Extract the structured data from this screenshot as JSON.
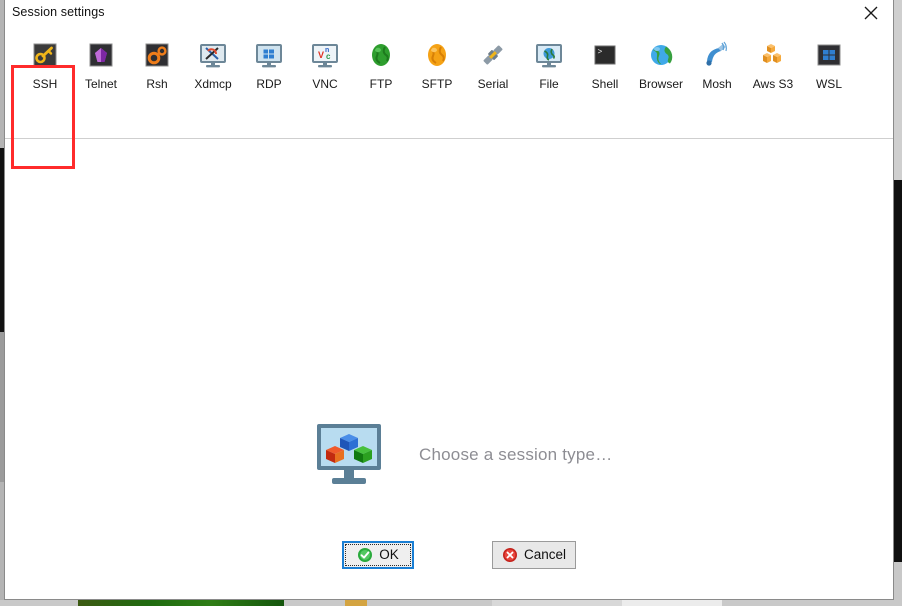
{
  "window": {
    "title": "Session settings",
    "close_icon": "close-x-icon"
  },
  "session_types": [
    {
      "id": "ssh",
      "label": "SSH",
      "icon": "ssh-key-icon",
      "selected": true
    },
    {
      "id": "telnet",
      "label": "Telnet",
      "icon": "telnet-gem-icon",
      "selected": false
    },
    {
      "id": "rsh",
      "label": "Rsh",
      "icon": "rsh-gears-icon",
      "selected": false
    },
    {
      "id": "xdmcp",
      "label": "Xdmcp",
      "icon": "xdmcp-monitor-icon",
      "selected": false
    },
    {
      "id": "rdp",
      "label": "RDP",
      "icon": "rdp-monitor-icon",
      "selected": false
    },
    {
      "id": "vnc",
      "label": "VNC",
      "icon": "vnc-monitor-icon",
      "selected": false
    },
    {
      "id": "ftp",
      "label": "FTP",
      "icon": "ftp-globe-icon",
      "selected": false
    },
    {
      "id": "sftp",
      "label": "SFTP",
      "icon": "sftp-globe-icon",
      "selected": false
    },
    {
      "id": "serial",
      "label": "Serial",
      "icon": "serial-plug-icon",
      "selected": false
    },
    {
      "id": "file",
      "label": "File",
      "icon": "file-monitor-icon",
      "selected": false
    },
    {
      "id": "shell",
      "label": "Shell",
      "icon": "shell-terminal-icon",
      "selected": false
    },
    {
      "id": "browser",
      "label": "Browser",
      "icon": "browser-globe-icon",
      "selected": false
    },
    {
      "id": "mosh",
      "label": "Mosh",
      "icon": "mosh-satellite-icon",
      "selected": false
    },
    {
      "id": "awss3",
      "label": "Aws S3",
      "icon": "aws-s3-cubes-icon",
      "selected": false
    },
    {
      "id": "wsl",
      "label": "WSL",
      "icon": "wsl-windows-icon",
      "selected": false
    }
  ],
  "placeholder": {
    "icon": "monitor-cubes-icon",
    "text": "Choose a session type…"
  },
  "footer": {
    "ok_label": "OK",
    "ok_icon": "green-check-icon",
    "cancel_label": "Cancel",
    "cancel_icon": "red-x-icon"
  },
  "colors": {
    "highlight_box": "#ff2b2b",
    "focus_border": "#1a7fd4",
    "ok_icon": "#2aaa3c",
    "cancel_icon": "#e23b32",
    "placeholder_text": "#8d8d93"
  }
}
